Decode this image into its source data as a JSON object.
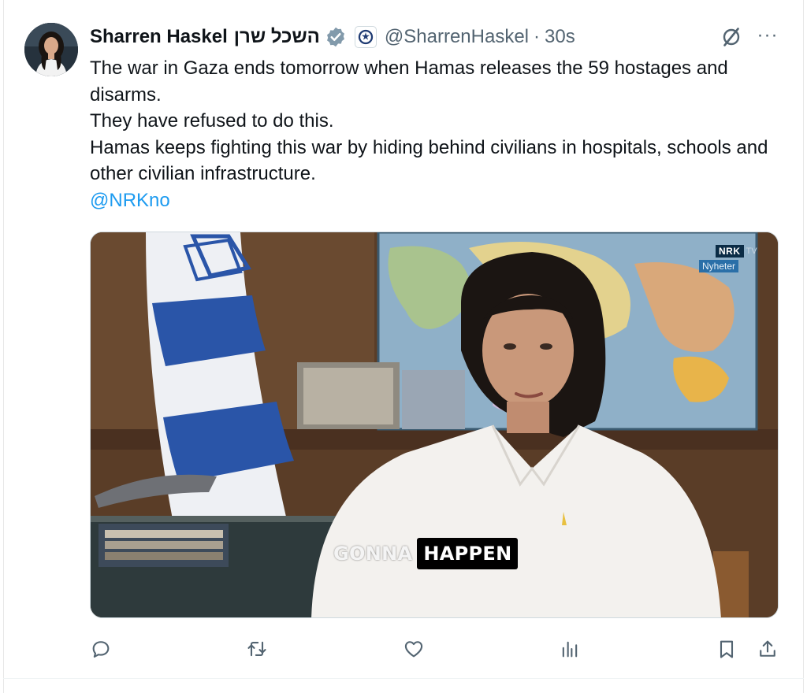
{
  "tweet": {
    "author_name": "Sharren Haskel",
    "author_name_hebrew": "השכל שרן",
    "handle": "@SharrenHaskel",
    "separator": "·",
    "timestamp": "30s",
    "verified": true,
    "more_label": "···",
    "body_lines": [
      "The war in Gaza ends tomorrow when Hamas releases the 59 hostages and disarms.",
      "They have refused to do this.",
      "Hamas keeps fighting this war by hiding behind civilians in hospitals, schools and other civilian infrastructure."
    ],
    "mention": "@NRKno"
  },
  "media": {
    "type": "video",
    "watermark_logo": "NRK",
    "watermark_tv": "TV",
    "watermark_sub": "Nyheter",
    "caption_part1": "GONNA",
    "caption_part2": "HAPPEN"
  },
  "actions": [
    {
      "name": "reply",
      "icon": "reply-icon"
    },
    {
      "name": "repost",
      "icon": "repost-icon"
    },
    {
      "name": "like",
      "icon": "heart-icon"
    },
    {
      "name": "views",
      "icon": "views-icon"
    },
    {
      "name": "bookmark",
      "icon": "bookmark-icon"
    },
    {
      "name": "share",
      "icon": "share-icon"
    }
  ],
  "colors": {
    "text": "#0f1419",
    "secondary": "#536471",
    "link": "#1d9bf0",
    "verified_badge": "#829aab"
  }
}
